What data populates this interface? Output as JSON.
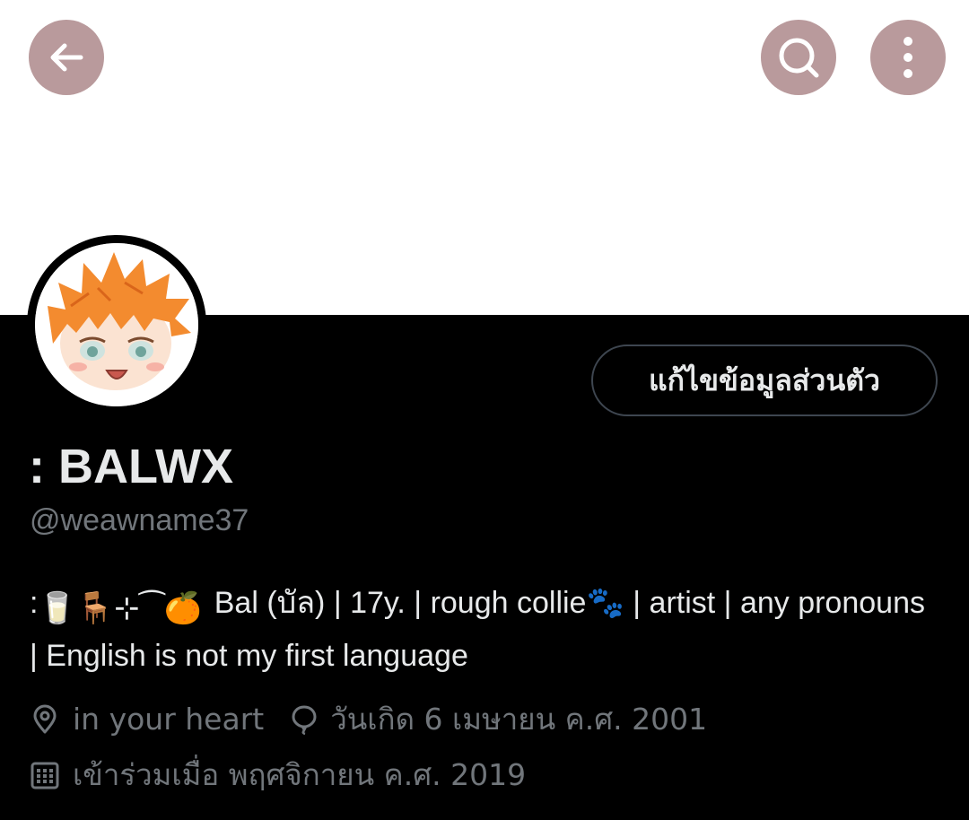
{
  "header": {
    "back_icon": "arrow-left-icon",
    "search_icon": "search-icon",
    "more_icon": "more-vertical-icon"
  },
  "profile": {
    "edit_button_label": "แก้ไขข้อมูลส่วนตัว",
    "display_name": ": BALWX",
    "handle": "@weawname37",
    "bio": {
      "prefix": ":",
      "emoji_sequence": "🥛🪑⊹⁀🍊",
      "text_part1": "Bal (บัล) | 17y. | rough collie",
      "paw_emoji": "🐾",
      "text_part2": " | artist | any pronouns | English is not my first language"
    },
    "location": "in your heart",
    "birthday": "วันเกิด 6 เมษายน ค.ศ. 2001",
    "joined": "เข้าร่วมเมื่อ พฤศจิกายน ค.ศ. 2019"
  },
  "colors": {
    "banner": "#ffffff",
    "background": "#000000",
    "header_button": "#b99a9c",
    "primary_text": "#e7e9ea",
    "secondary_text": "#71767b"
  }
}
